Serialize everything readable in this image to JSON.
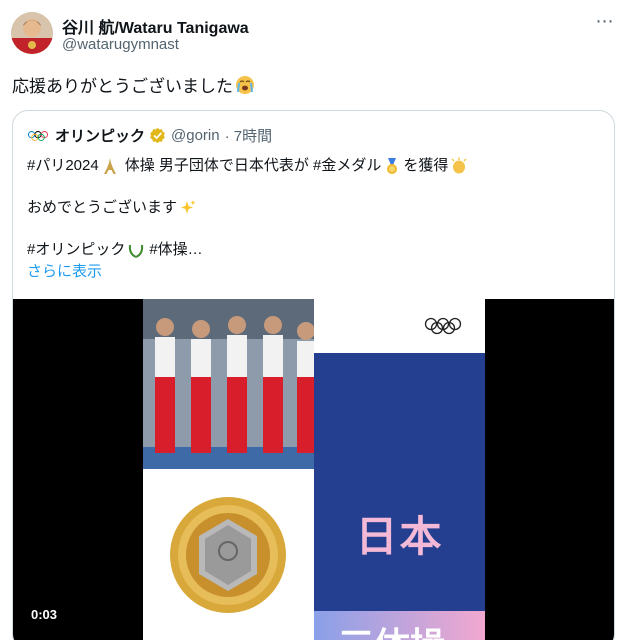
{
  "author": {
    "name": "谷川 航/Wataru Tanigawa",
    "handle": "@watarugymnast",
    "avatar_icon": "avatar-photo"
  },
  "tweet": {
    "text": "応援ありがとうございました",
    "emoji": "loudly-crying-face"
  },
  "more_icon": "⋯",
  "quote": {
    "account_name": "オリンピック",
    "handle": "@gorin",
    "time": "· 7時間",
    "verified_color": "#e2b719",
    "lines": {
      "line1_a": "#パリ2024",
      "line1_b": "体操 男子団体で日本代表が #金メダル",
      "line1_c": "を獲得",
      "line2": "おめでとうございます",
      "line3_a": "#オリンピック",
      "line3_b": "#体操…"
    },
    "show_more": "さらに表示"
  },
  "media": {
    "video_time": "0:03",
    "panel_text_japan": "日本",
    "panel_text_gymnastics": "三体操"
  },
  "colors": {
    "link": "#1d9bf0",
    "panel_blue": "#243f8f",
    "gold": "#d9a83a"
  }
}
